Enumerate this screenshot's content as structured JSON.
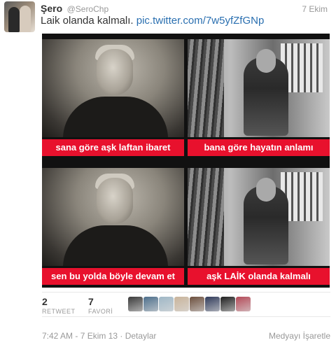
{
  "author": {
    "name": "Şero",
    "handle": "@SeroChp"
  },
  "tweet": {
    "date": "7 Ekim",
    "text": "Laik olanda kalmalı.",
    "link": "pic.twitter.com/7w5yfZfGNp"
  },
  "media": {
    "captions": [
      "sana göre aşk laftan ibaret",
      "bana göre hayatın anlamı",
      "sen bu yolda böyle devam et",
      "aşk LAİK olanda kalmalı"
    ],
    "caption_color": "#e8112d"
  },
  "stats": {
    "retweets": {
      "count": "2",
      "label": "RETWEET"
    },
    "favorites": {
      "count": "7",
      "label": "FAVORİ"
    }
  },
  "favoriters": [
    {
      "name": "user-avatar-1",
      "color": "#3a3a3a"
    },
    {
      "name": "user-avatar-2",
      "color": "#4d6f8c"
    },
    {
      "name": "user-avatar-3",
      "color": "#9fb7c6"
    },
    {
      "name": "user-avatar-4",
      "color": "#c9b49b"
    },
    {
      "name": "user-avatar-5",
      "color": "#6c4f3d"
    },
    {
      "name": "user-avatar-6",
      "color": "#2f3a5a"
    },
    {
      "name": "user-avatar-7",
      "color": "#1f1f1f"
    },
    {
      "name": "user-avatar-8",
      "color": "#b44a58"
    }
  ],
  "footer": {
    "timestamp": "7:42 AM - 7 Ekim 13",
    "separator": " · ",
    "details": "Detaylar",
    "flag_media": "Medyayı İşaretle"
  }
}
